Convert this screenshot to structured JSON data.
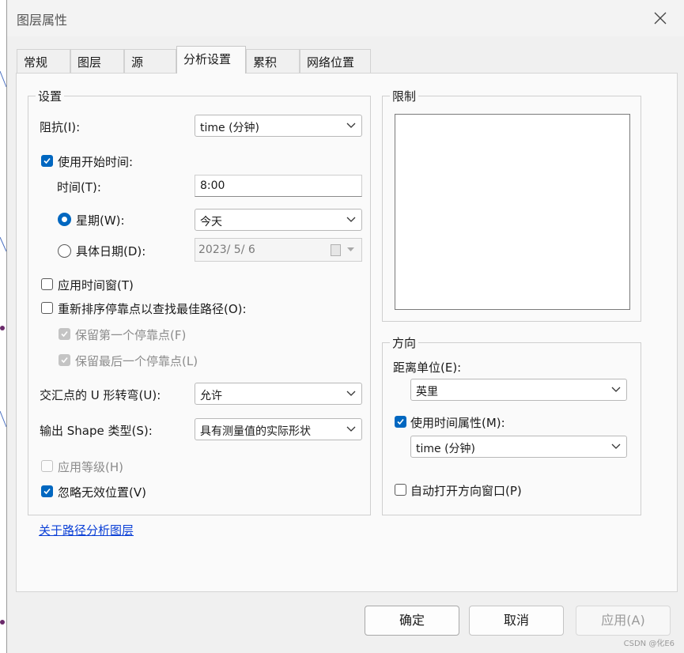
{
  "window": {
    "title": "图层属性",
    "close_icon": "close-icon"
  },
  "tabs": [
    {
      "label": "常规",
      "active": false
    },
    {
      "label": "图层",
      "active": false
    },
    {
      "label": "源",
      "active": false
    },
    {
      "label": "分析设置",
      "active": true
    },
    {
      "label": "累积",
      "active": false
    },
    {
      "label": "网络位置",
      "active": false
    }
  ],
  "settings": {
    "group_label": "设置",
    "impedance_label": "阻抗(I):",
    "impedance_value": "time (分钟)",
    "use_start_time_label": "使用开始时间:",
    "use_start_time_checked": true,
    "time_label": "时间(T):",
    "time_value": "8:00",
    "weekday_label": "星期(W):",
    "weekday_selected": true,
    "weekday_value": "今天",
    "specific_date_label": "具体日期(D):",
    "specific_date_selected": false,
    "specific_date_value": "2023/  5/  6",
    "apply_time_window_label": "应用时间窗(T)",
    "apply_time_window_checked": false,
    "reorder_stops_label": "重新排序停靠点以查找最佳路径(O):",
    "reorder_stops_checked": false,
    "keep_first_stop_label": "保留第一个停靠点(F)",
    "keep_first_stop_checked": true,
    "keep_last_stop_label": "保留最后一个停靠点(L)",
    "keep_last_stop_checked": true,
    "uturn_label": "交汇点的 U 形转弯(U):",
    "uturn_value": "允许",
    "shape_type_label": "输出 Shape 类型(S):",
    "shape_type_value": "具有测量值的实际形状",
    "use_hierarchy_label": "应用等级(H)",
    "use_hierarchy_checked": false,
    "ignore_invalid_label": "忽略无效位置(V)",
    "ignore_invalid_checked": true
  },
  "restrictions": {
    "group_label": "限制"
  },
  "directions": {
    "group_label": "方向",
    "distance_units_label": "距离单位(E):",
    "distance_units_value": "英里",
    "use_time_attribute_label": "使用时间属性(M):",
    "use_time_attribute_checked": true,
    "time_attribute_value": "time (分钟)",
    "auto_open_label": "自动打开方向窗口(P)",
    "auto_open_checked": false
  },
  "link": {
    "label": "关于路径分析图层"
  },
  "buttons": {
    "ok": "确定",
    "cancel": "取消",
    "apply": "应用(A)"
  },
  "watermark": "CSDN @化E6",
  "colors": {
    "accent": "#0067c0",
    "link": "#0a3fd6"
  }
}
